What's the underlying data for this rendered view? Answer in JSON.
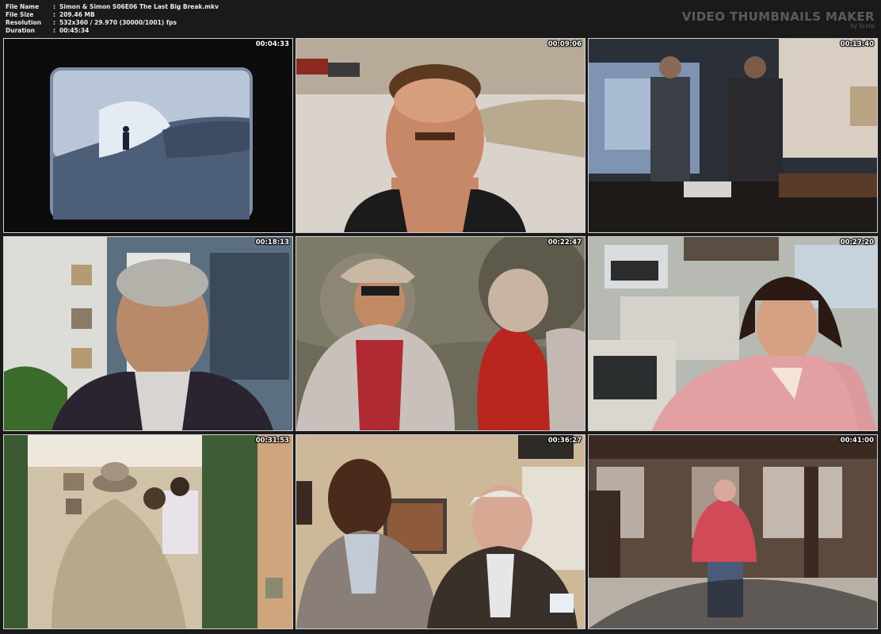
{
  "file_info": {
    "file_name": {
      "key": "File Name",
      "value": "Simon & Simon S06E06 The Last Big Break.mkv"
    },
    "file_size": {
      "key": "File Size",
      "value": "209.46 MB"
    },
    "resolution": {
      "key": "Resolution",
      "value": "532x360 / 29.970 (30000/1001) fps"
    },
    "duration": {
      "key": "Duration",
      "value": "00:45:34"
    },
    "separator": ":"
  },
  "brand": {
    "title": "VIDEO THUMBNAILS MAKER",
    "subtitle": "by Scorp"
  },
  "thumbnails": [
    {
      "timestamp": "00:04:33"
    },
    {
      "timestamp": "00:09:06"
    },
    {
      "timestamp": "00:13:40"
    },
    {
      "timestamp": "00:18:13"
    },
    {
      "timestamp": "00:22:47"
    },
    {
      "timestamp": "00:27:20"
    },
    {
      "timestamp": "00:31:53"
    },
    {
      "timestamp": "00:36:27"
    },
    {
      "timestamp": "00:41:00"
    }
  ]
}
